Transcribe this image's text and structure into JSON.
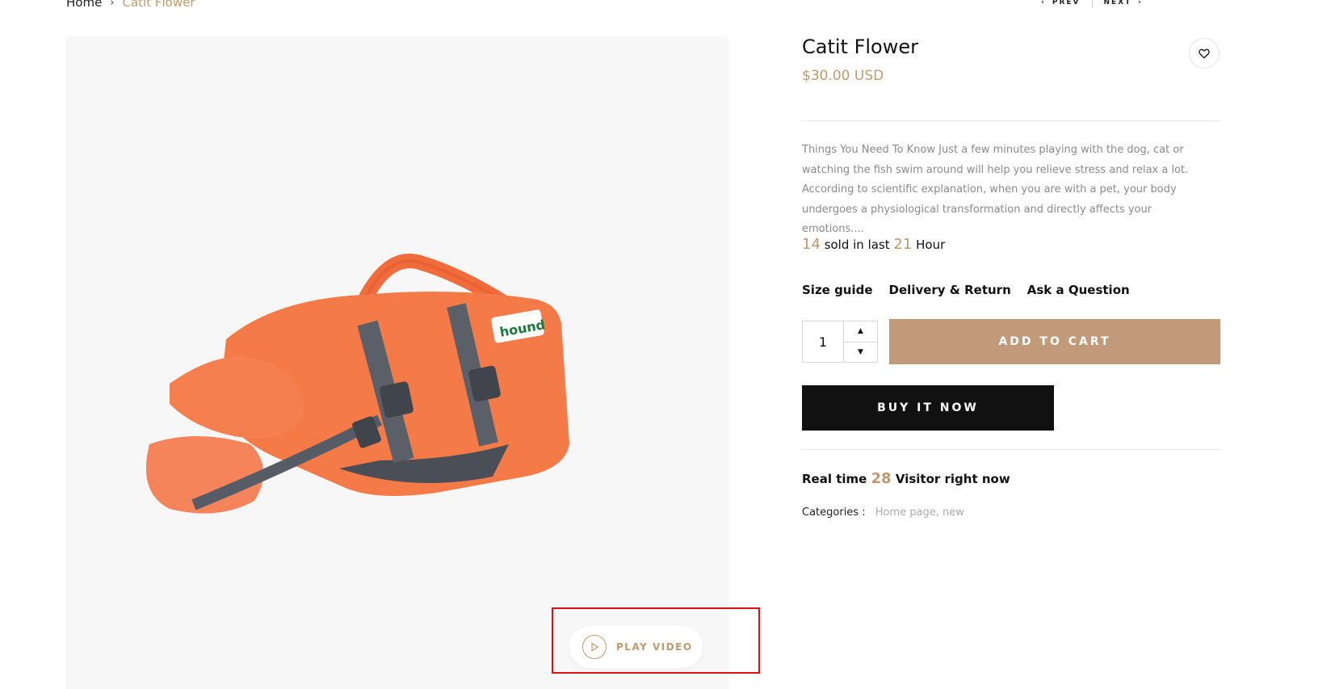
{
  "breadcrumb": {
    "home": "Home",
    "current": "Catit Flower"
  },
  "nav": {
    "prev": "PREV",
    "next": "NEXT"
  },
  "product": {
    "title": "Catit Flower",
    "price": "$30.00 USD",
    "description": "Things You Need To Know Just a few minutes playing with the dog, cat or watching the fish swim around will help you relieve stress and relax a lot. According to scientific explanation, when you are with a pet, your body undergoes a physiological transformation and directly affects your emotions....",
    "sold": {
      "count": "14",
      "mid": "sold in last",
      "hours": "21",
      "unit": "Hour"
    },
    "links": [
      "Size guide",
      "Delivery & Return",
      "Ask a Question"
    ],
    "quantity": "1",
    "add_to_cart": "ADD TO CART",
    "buy_now": "BUY IT NOW",
    "visitors": {
      "prefix": "Real time",
      "count": "28",
      "suffix": "Visitor right now"
    },
    "categories": {
      "label": "Categories :",
      "values": "Home page, new"
    }
  },
  "gallery": {
    "play_video": "PLAY VIDEO",
    "vest_brand": "hound"
  },
  "colors": {
    "accent": "#c19a6b",
    "button_cart": "#c19a7a",
    "button_buy": "#111111",
    "highlight": "#e01010"
  }
}
